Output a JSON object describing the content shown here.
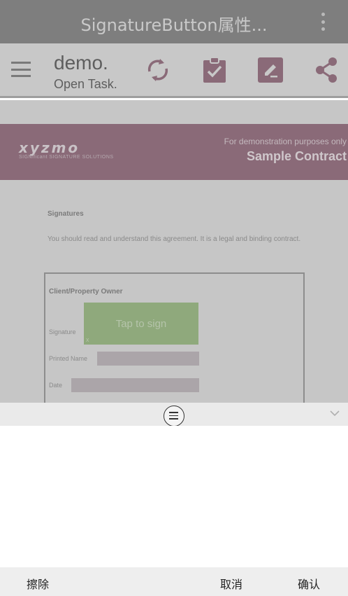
{
  "titlebar": {
    "title": "SignatureButton属性..."
  },
  "toolbar": {
    "app_name": "demo.",
    "app_sub": "Open Task.",
    "icons": [
      "menu-icon",
      "sync-icon",
      "clipboard-check-icon",
      "edit-icon",
      "share-icon"
    ],
    "icon_color": "#8a6a78"
  },
  "document": {
    "banner": {
      "logo": "xyzmo",
      "logo_sub": "SIGNificant SIGNATURE SOLUTIONS",
      "demo_text": "For demonstration purposes only",
      "contract_title": "Sample Contract",
      "color": "#8a6a78"
    },
    "heading": "Signatures",
    "paragraph": "You should read and understand this agreement. It is a legal and binding contract.",
    "client_box": {
      "title": "Client/Property Owner",
      "signature_label": "Signature",
      "sign_button": "Tap to sign",
      "sign_mark": "x",
      "printed_name_label": "Printed Name",
      "date_label": "Date"
    }
  },
  "handle": {
    "icons": [
      "drag-handle-icon",
      "chevron-down-icon"
    ]
  },
  "actions": {
    "erase": "擦除",
    "cancel": "取消",
    "confirm": "确认"
  }
}
